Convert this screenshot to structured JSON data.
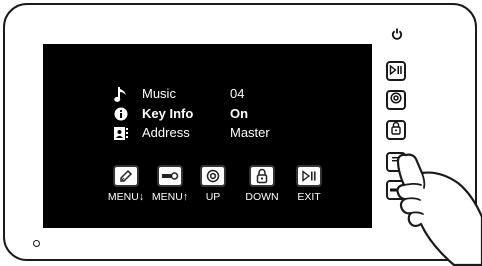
{
  "menu": {
    "items": [
      {
        "label": "Music",
        "value": "04",
        "icon": "music-note-icon"
      },
      {
        "label": "Key Info",
        "value": "On",
        "icon": "info-icon"
      },
      {
        "label": "Address",
        "value": "Master",
        "icon": "address-book-icon"
      }
    ],
    "selected_index": 1
  },
  "onscreen_buttons": [
    {
      "label": "MENU↓",
      "icon": "pen-icon"
    },
    {
      "label": "MENU↑",
      "icon": "key-icon"
    },
    {
      "label": "UP",
      "icon": "intercom-icon"
    },
    {
      "label": "DOWN",
      "icon": "lock-icon"
    },
    {
      "label": "EXIT",
      "icon": "play-pause-icon"
    }
  ],
  "side_buttons": [
    "power-icon",
    "play-pause-icon",
    "intercom-icon",
    "lock-icon",
    "menu-icon",
    "key-icon"
  ],
  "colors": {
    "screen": "#000000",
    "text": "#ffffff",
    "frame": "#1a1a1a"
  }
}
